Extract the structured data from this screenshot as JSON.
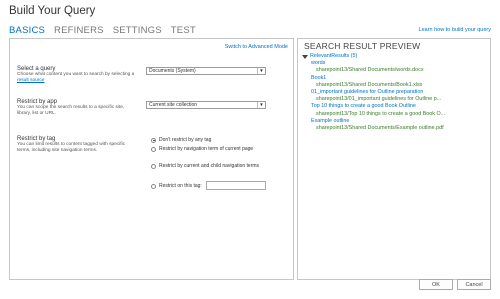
{
  "dialog": {
    "title": "Build Your Query",
    "learn_link": "Learn how to build your query"
  },
  "tabs": [
    "BASICS",
    "REFINERS",
    "SETTINGS",
    "TEST"
  ],
  "left": {
    "advanced_link": "Switch to Advanced Mode",
    "query": {
      "title": "Select a query",
      "desc": "Choose what content you want to search by selecting a",
      "desc_link": "result source",
      "selected": "Documents (System)"
    },
    "app": {
      "title": "Restrict by app",
      "desc": "You can scope the search results to a specific site, library, list or URL.",
      "selected": "Current site collection"
    },
    "tag": {
      "title": "Restrict by tag",
      "desc": "You can limit results to content tagged with specific terms, including site navigation terms.",
      "options": [
        "Don't restrict by any tag",
        "Restrict by navigation term of current page",
        "Restrict by current and child navigation terms",
        "Restrict on this tag:"
      ]
    }
  },
  "preview": {
    "header": "SEARCH RESULT PREVIEW",
    "group": "RelevantResults (5)",
    "items": [
      {
        "title": "words",
        "url": "sharepoint13/Shared Documents/words.docx"
      },
      {
        "title": "Book1",
        "url": "sharepoint13/Shared Documents/Book1.xlsx"
      },
      {
        "title": "01_important guidelines for Outline preparation",
        "url": "sharepoint13/01_important guidelines for Outline p..."
      },
      {
        "title": "Top 10 things to create a good Book Outline",
        "url": "sharepoint13/Top 10 things to create a good Book O..."
      },
      {
        "title": "Example outline",
        "url": "sharepoint13/Shared Documents/Example outline.pdf"
      }
    ]
  },
  "buttons": {
    "ok": "OK",
    "cancel": "Cancel"
  }
}
